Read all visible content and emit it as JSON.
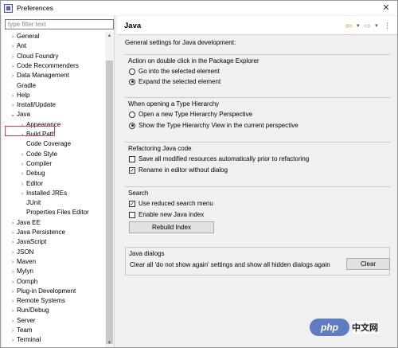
{
  "window": {
    "title": "Preferences",
    "close_glyph": "✕"
  },
  "filter": {
    "placeholder": "type filter text"
  },
  "tree": [
    {
      "label": "General",
      "level": 0,
      "expander": "closed"
    },
    {
      "label": "Ant",
      "level": 0,
      "expander": "closed"
    },
    {
      "label": "Cloud Foundry",
      "level": 0,
      "expander": "closed"
    },
    {
      "label": "Code Recommenders",
      "level": 0,
      "expander": "closed"
    },
    {
      "label": "Data Management",
      "level": 0,
      "expander": "closed"
    },
    {
      "label": "Gradle",
      "level": 0,
      "expander": "none"
    },
    {
      "label": "Help",
      "level": 0,
      "expander": "closed"
    },
    {
      "label": "Install/Update",
      "level": 0,
      "expander": "closed"
    },
    {
      "label": "Java",
      "level": 0,
      "expander": "open",
      "highlighted": true
    },
    {
      "label": "Appearance",
      "level": 1,
      "expander": "closed"
    },
    {
      "label": "Build Path",
      "level": 1,
      "expander": "closed"
    },
    {
      "label": "Code Coverage",
      "level": 1,
      "expander": "none"
    },
    {
      "label": "Code Style",
      "level": 1,
      "expander": "closed"
    },
    {
      "label": "Compiler",
      "level": 1,
      "expander": "closed"
    },
    {
      "label": "Debug",
      "level": 1,
      "expander": "closed"
    },
    {
      "label": "Editor",
      "level": 1,
      "expander": "closed"
    },
    {
      "label": "Installed JREs",
      "level": 1,
      "expander": "closed"
    },
    {
      "label": "JUnit",
      "level": 1,
      "expander": "none"
    },
    {
      "label": "Properties Files Editor",
      "level": 1,
      "expander": "none"
    },
    {
      "label": "Java EE",
      "level": 0,
      "expander": "closed"
    },
    {
      "label": "Java Persistence",
      "level": 0,
      "expander": "closed"
    },
    {
      "label": "JavaScript",
      "level": 0,
      "expander": "closed"
    },
    {
      "label": "JSON",
      "level": 0,
      "expander": "closed"
    },
    {
      "label": "Maven",
      "level": 0,
      "expander": "closed"
    },
    {
      "label": "Mylyn",
      "level": 0,
      "expander": "closed"
    },
    {
      "label": "Oomph",
      "level": 0,
      "expander": "closed"
    },
    {
      "label": "Plug-in Development",
      "level": 0,
      "expander": "closed"
    },
    {
      "label": "Remote Systems",
      "level": 0,
      "expander": "closed"
    },
    {
      "label": "Run/Debug",
      "level": 0,
      "expander": "closed"
    },
    {
      "label": "Server",
      "level": 0,
      "expander": "closed"
    },
    {
      "label": "Team",
      "level": 0,
      "expander": "closed"
    },
    {
      "label": "Terminal",
      "level": 0,
      "expander": "closed"
    }
  ],
  "page": {
    "title": "Java",
    "description": "General settings for Java development:",
    "nav": {
      "back_glyph": "⇦",
      "forward_glyph": "⇨",
      "dropdown_glyph": "▼",
      "menu_glyph": "⋮"
    }
  },
  "groups": {
    "package_explorer": {
      "title": "Action on double click in the Package Explorer",
      "options": [
        {
          "label": "Go into the selected element",
          "selected": false
        },
        {
          "label": "Expand the selected element",
          "selected": true
        }
      ]
    },
    "type_hierarchy": {
      "title": "When opening a Type Hierarchy",
      "options": [
        {
          "label": "Open a new Type Hierarchy Perspective",
          "selected": false
        },
        {
          "label": "Show the Type Hierarchy View in the current perspective",
          "selected": true
        }
      ]
    },
    "refactoring": {
      "title": "Refactoring Java code",
      "options": [
        {
          "label": "Save all modified resources automatically prior to refactoring",
          "checked": false
        },
        {
          "label": "Rename in editor without dialog",
          "checked": true
        }
      ]
    },
    "search": {
      "title": "Search",
      "options": [
        {
          "label": "Use reduced search menu",
          "checked": true
        },
        {
          "label": "Enable new Java index",
          "checked": false
        }
      ],
      "button": "Rebuild Index"
    },
    "dialogs": {
      "title": "Java dialogs",
      "text": "Clear all 'do not show again' settings and show all hidden dialogs again",
      "button": "Clear"
    }
  },
  "watermark": {
    "logo": "php",
    "text": "中文网"
  },
  "colors": {
    "highlight_border": "#e53935",
    "nav_back": "#e0a020"
  }
}
